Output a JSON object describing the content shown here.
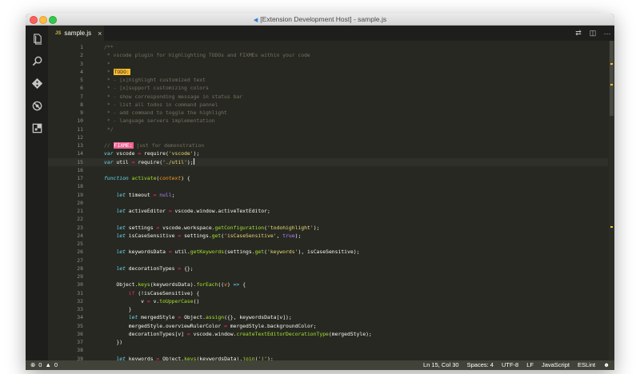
{
  "window": {
    "title": "[Extension Development Host] - sample.js"
  },
  "activity_bar": [
    "explorer-icon",
    "search-icon",
    "source-control-icon",
    "debug-icon",
    "extensions-icon"
  ],
  "tab": {
    "lang": "JS",
    "name": "sample.js",
    "close": "×"
  },
  "tab_actions": [
    "⇄",
    "◫",
    "···"
  ],
  "editor": {
    "current_line": 15,
    "lines": [
      {
        "n": "1",
        "t": [
          [
            "c-com",
            "/**"
          ]
        ]
      },
      {
        "n": "2",
        "t": [
          [
            "c-com",
            " * vscode plugin for highlighting TODOs and FIXMEs within your code"
          ]
        ]
      },
      {
        "n": "3",
        "t": [
          [
            "c-com",
            " *"
          ]
        ]
      },
      {
        "n": "4",
        "t": [
          [
            "c-com",
            " * "
          ],
          [
            "tag-todo",
            "TODO:"
          ]
        ]
      },
      {
        "n": "5",
        "t": [
          [
            "c-com",
            " * - [x]highlight customized text"
          ]
        ]
      },
      {
        "n": "6",
        "t": [
          [
            "c-com",
            " * - [x]support customizing colors"
          ]
        ]
      },
      {
        "n": "7",
        "t": [
          [
            "c-com",
            " * - show corresponding message in status bar"
          ]
        ]
      },
      {
        "n": "8",
        "t": [
          [
            "c-com",
            " * - list all todos in command pannel"
          ]
        ]
      },
      {
        "n": "9",
        "t": [
          [
            "c-com",
            " * - add command to toggle the highlight"
          ]
        ]
      },
      {
        "n": "10",
        "t": [
          [
            "c-com",
            " * - language servers implementation"
          ]
        ]
      },
      {
        "n": "11",
        "t": [
          [
            "c-com",
            " */"
          ]
        ]
      },
      {
        "n": "12",
        "t": []
      },
      {
        "n": "13",
        "t": [
          [
            "c-com",
            "// "
          ],
          [
            "tag-fixme",
            "FIXME:"
          ],
          [
            "c-com",
            " just for demonstration"
          ]
        ]
      },
      {
        "n": "14",
        "t": [
          [
            "c-kw",
            "var"
          ],
          [
            "c-plain",
            " vscode "
          ],
          [
            "c-pink",
            "="
          ],
          [
            "c-plain",
            " require("
          ],
          [
            "c-str",
            "'vscode'"
          ],
          [
            "c-plain",
            ");"
          ]
        ]
      },
      {
        "n": "15",
        "t": [
          [
            "c-kw",
            "var"
          ],
          [
            "c-plain",
            " util "
          ],
          [
            "c-pink",
            "="
          ],
          [
            "c-plain",
            " require("
          ],
          [
            "c-str",
            "'./util'"
          ],
          [
            "c-plain",
            ");"
          ],
          [
            "cursor",
            ""
          ]
        ]
      },
      {
        "n": "16",
        "t": []
      },
      {
        "n": "17",
        "t": [
          [
            "c-kw",
            "function"
          ],
          [
            "c-plain",
            " "
          ],
          [
            "c-fn",
            "activate"
          ],
          [
            "c-plain",
            "("
          ],
          [
            "c-param",
            "context"
          ],
          [
            "c-plain",
            ") {"
          ]
        ]
      },
      {
        "n": "18",
        "t": []
      },
      {
        "n": "19",
        "t": [
          [
            "c-plain",
            "    "
          ],
          [
            "c-kw",
            "let"
          ],
          [
            "c-plain",
            " timeout "
          ],
          [
            "c-pink",
            "="
          ],
          [
            "c-plain",
            " "
          ],
          [
            "c-bool",
            "null"
          ],
          [
            "c-plain",
            ";"
          ]
        ]
      },
      {
        "n": "20",
        "t": []
      },
      {
        "n": "21",
        "t": [
          [
            "c-plain",
            "    "
          ],
          [
            "c-kw",
            "let"
          ],
          [
            "c-plain",
            " activeEditor "
          ],
          [
            "c-pink",
            "="
          ],
          [
            "c-plain",
            " vscode.window.activeTextEditor;"
          ]
        ]
      },
      {
        "n": "22",
        "t": []
      },
      {
        "n": "23",
        "t": [
          [
            "c-plain",
            "    "
          ],
          [
            "c-kw",
            "let"
          ],
          [
            "c-plain",
            " settings "
          ],
          [
            "c-pink",
            "="
          ],
          [
            "c-plain",
            " vscode.workspace."
          ],
          [
            "c-fn",
            "getConfiguration"
          ],
          [
            "c-plain",
            "("
          ],
          [
            "c-str",
            "'todohighlight'"
          ],
          [
            "c-plain",
            ");"
          ]
        ]
      },
      {
        "n": "24",
        "t": [
          [
            "c-plain",
            "    "
          ],
          [
            "c-kw",
            "let"
          ],
          [
            "c-plain",
            " isCaseSensitive "
          ],
          [
            "c-pink",
            "="
          ],
          [
            "c-plain",
            " settings."
          ],
          [
            "c-fn",
            "get"
          ],
          [
            "c-plain",
            "("
          ],
          [
            "c-str",
            "'isCaseSensitive'"
          ],
          [
            "c-plain",
            ", "
          ],
          [
            "c-bool",
            "true"
          ],
          [
            "c-plain",
            ");"
          ]
        ]
      },
      {
        "n": "25",
        "t": []
      },
      {
        "n": "26",
        "t": [
          [
            "c-plain",
            "    "
          ],
          [
            "c-kw",
            "let"
          ],
          [
            "c-plain",
            " keywordsData "
          ],
          [
            "c-pink",
            "="
          ],
          [
            "c-plain",
            " util."
          ],
          [
            "c-fn",
            "getKeywords"
          ],
          [
            "c-plain",
            "(settings."
          ],
          [
            "c-fn",
            "get"
          ],
          [
            "c-plain",
            "("
          ],
          [
            "c-str",
            "'keywords'"
          ],
          [
            "c-plain",
            "), isCaseSensitive);"
          ]
        ]
      },
      {
        "n": "27",
        "t": []
      },
      {
        "n": "28",
        "t": [
          [
            "c-plain",
            "    "
          ],
          [
            "c-kw",
            "let"
          ],
          [
            "c-plain",
            " decorationTypes "
          ],
          [
            "c-pink",
            "="
          ],
          [
            "c-plain",
            " {};"
          ]
        ]
      },
      {
        "n": "29",
        "t": []
      },
      {
        "n": "30",
        "t": [
          [
            "c-plain",
            "    Object."
          ],
          [
            "c-fn",
            "keys"
          ],
          [
            "c-plain",
            "(keywordsData)."
          ],
          [
            "c-fn",
            "forEach"
          ],
          [
            "c-plain",
            "(("
          ],
          [
            "c-param",
            "v"
          ],
          [
            "c-plain",
            ") "
          ],
          [
            "c-kw",
            "=>"
          ],
          [
            "c-plain",
            " {"
          ]
        ]
      },
      {
        "n": "31",
        "t": [
          [
            "c-plain",
            "        "
          ],
          [
            "c-pink",
            "if"
          ],
          [
            "c-plain",
            " (!isCaseSensitive) {"
          ]
        ]
      },
      {
        "n": "32",
        "t": [
          [
            "c-plain",
            "            v "
          ],
          [
            "c-pink",
            "="
          ],
          [
            "c-plain",
            " v."
          ],
          [
            "c-fn",
            "toUpperCase"
          ],
          [
            "c-plain",
            "()"
          ]
        ]
      },
      {
        "n": "33",
        "t": [
          [
            "c-plain",
            "        }"
          ]
        ]
      },
      {
        "n": "34",
        "t": [
          [
            "c-plain",
            "        "
          ],
          [
            "c-kw",
            "let"
          ],
          [
            "c-plain",
            " mergedStyle "
          ],
          [
            "c-pink",
            "="
          ],
          [
            "c-plain",
            " Object."
          ],
          [
            "c-fn",
            "assign"
          ],
          [
            "c-plain",
            "({}, keywordsData[v]);"
          ]
        ]
      },
      {
        "n": "35",
        "t": [
          [
            "c-plain",
            "        mergedStyle.overviewRulerColor "
          ],
          [
            "c-pink",
            "="
          ],
          [
            "c-plain",
            " mergedStyle.backgroundColor;"
          ]
        ]
      },
      {
        "n": "36",
        "t": [
          [
            "c-plain",
            "        decorationTypes[v] "
          ],
          [
            "c-pink",
            "="
          ],
          [
            "c-plain",
            " vscode.window."
          ],
          [
            "c-fn",
            "createTextEditorDecorationType"
          ],
          [
            "c-plain",
            "(mergedStyle);"
          ]
        ]
      },
      {
        "n": "37",
        "t": [
          [
            "c-plain",
            "    })"
          ]
        ]
      },
      {
        "n": "38",
        "t": []
      },
      {
        "n": "39",
        "t": [
          [
            "c-plain",
            "    "
          ],
          [
            "c-kw",
            "let"
          ],
          [
            "c-plain",
            " keywords "
          ],
          [
            "c-pink",
            "="
          ],
          [
            "c-plain",
            " Object."
          ],
          [
            "c-fn",
            "keys"
          ],
          [
            "c-plain",
            "(keywordsData)."
          ],
          [
            "c-fn",
            "join"
          ],
          [
            "c-plain",
            "("
          ],
          [
            "c-str",
            "'|'"
          ],
          [
            "c-plain",
            ");"
          ]
        ]
      }
    ]
  },
  "status": {
    "errors_icon": "⊗",
    "errors": "0",
    "warnings_icon": "▲",
    "warnings": "0",
    "position": "Ln 15, Col 30",
    "spaces": "Spaces: 4",
    "encoding": "UTF-8",
    "eol": "LF",
    "language": "JavaScript",
    "linter": "ESLint",
    "feedback": "☻"
  },
  "colors": {
    "editor_bg": "#272822",
    "todo_bg": "#ffbd2a",
    "fixme_bg": "#f06292",
    "status_bg": "#414339"
  }
}
